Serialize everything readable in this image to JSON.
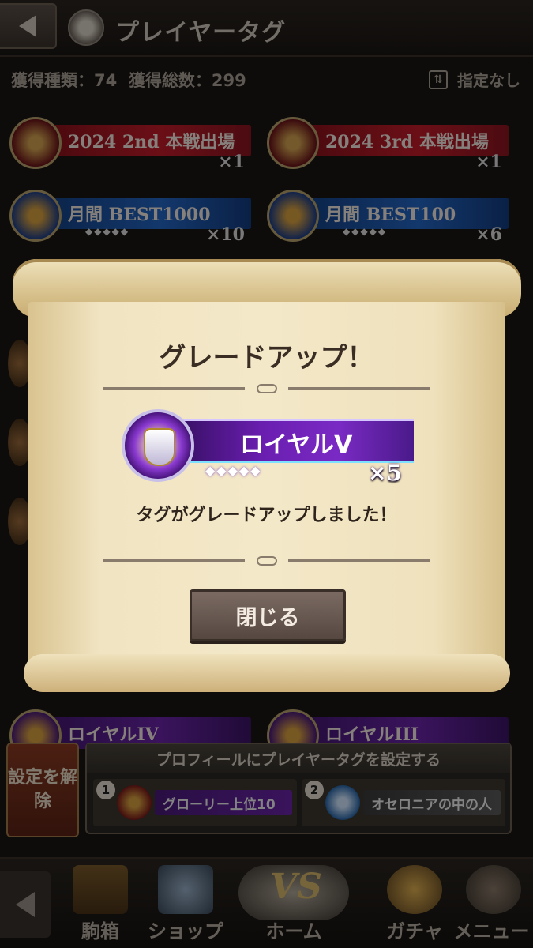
{
  "header": {
    "title": "プレイヤータグ"
  },
  "stats": {
    "types": "獲得種類：74",
    "total": "獲得総数：299"
  },
  "filter": {
    "label": "指定なし"
  },
  "tags": [
    {
      "name": "2024 2nd 本戦出場",
      "count": "×1",
      "diamonds": ""
    },
    {
      "name": "2024 3rd 本戦出場",
      "count": "×1",
      "diamonds": ""
    },
    {
      "name": "月間 BEST1000",
      "count": "×10",
      "diamonds": "◆◆◆◆◆"
    },
    {
      "name": "月間 BEST100",
      "count": "×6",
      "diamonds": "◆◆◆◆◆"
    },
    {
      "name": "ロイヤルIV",
      "count": "",
      "diamonds": ""
    },
    {
      "name": "ロイヤルIII",
      "count": "",
      "diamonds": ""
    }
  ],
  "modal": {
    "title": "グレードアップ！",
    "badge": {
      "name": "ロイヤルV",
      "count": "×5",
      "diamonds": "◆◆◆◆◆"
    },
    "message": "タグがグレードアップしました！",
    "close_label": "閉じる"
  },
  "profile": {
    "unset_label": "設定を解除",
    "heading": "プロフィールにプレイヤータグを設定する",
    "slot1": {
      "num": "1",
      "label": "グローリー上位10"
    },
    "slot2": {
      "num": "2",
      "label": "オセロニアの中の人"
    }
  },
  "nav": {
    "box": "駒箱",
    "shop": "ショップ",
    "home": "ホーム",
    "home_logo": "VS",
    "gacha": "ガチャ",
    "menu": "メニュー"
  }
}
